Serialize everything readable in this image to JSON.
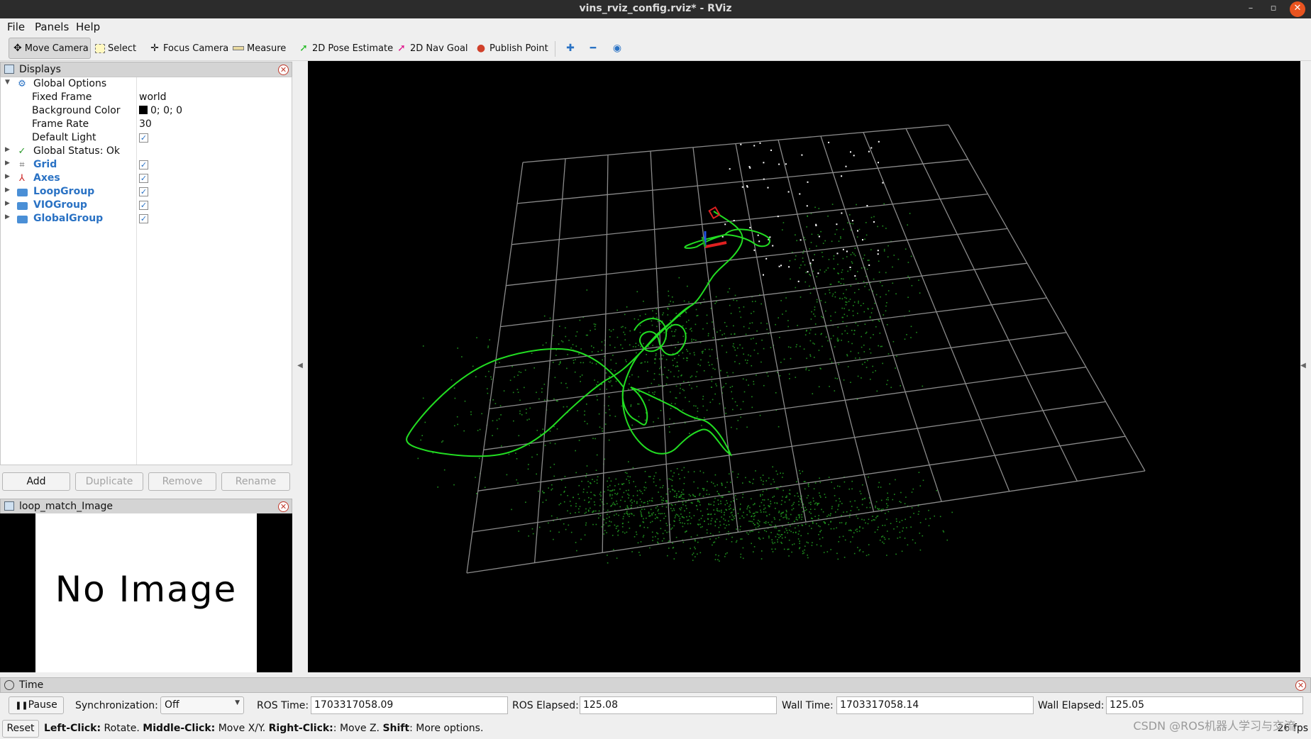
{
  "window": {
    "title": "vins_rviz_config.rviz* - RViz"
  },
  "menubar": {
    "file": "File",
    "panels": "Panels",
    "help": "Help"
  },
  "toolbar": {
    "move_camera": "Move Camera",
    "select": "Select",
    "focus_camera": "Focus Camera",
    "measure": "Measure",
    "pose_estimate": "2D Pose Estimate",
    "nav_goal": "2D Nav Goal",
    "publish_point": "Publish Point"
  },
  "displays": {
    "title": "Displays",
    "global_options": "Global Options",
    "fixed_frame_label": "Fixed Frame",
    "fixed_frame_value": "world",
    "background_color_label": "Background Color",
    "background_color_value": "0; 0; 0",
    "frame_rate_label": "Frame Rate",
    "frame_rate_value": "30",
    "default_light_label": "Default Light",
    "global_status": "Global Status: Ok",
    "items": [
      {
        "label": "Grid",
        "checked": true
      },
      {
        "label": "Axes",
        "checked": true
      },
      {
        "label": "LoopGroup",
        "checked": true
      },
      {
        "label": "VIOGroup",
        "checked": true
      },
      {
        "label": "GlobalGroup",
        "checked": true
      }
    ],
    "buttons": {
      "add": "Add",
      "duplicate": "Duplicate",
      "remove": "Remove",
      "rename": "Rename"
    }
  },
  "image_panel": {
    "title": "loop_match_Image",
    "placeholder": "No Image"
  },
  "time_panel": {
    "title": "Time",
    "pause": "Pause",
    "sync_label": "Synchronization:",
    "sync_value": "Off",
    "ros_time_label": "ROS Time:",
    "ros_time": "1703317058.09",
    "ros_elapsed_label": "ROS Elapsed:",
    "ros_elapsed": "125.08",
    "wall_time_label": "Wall Time:",
    "wall_time": "1703317058.14",
    "wall_elapsed_label": "Wall Elapsed:",
    "wall_elapsed": "125.05"
  },
  "statusbar": {
    "reset": "Reset",
    "k1": "Left-Click:",
    "v1": " Rotate. ",
    "k2": "Middle-Click:",
    "v2": " Move X/Y. ",
    "k3": "Right-Click:",
    "v3": ": Move Z. ",
    "k4": "Shift",
    "v4": ": More options.",
    "fps": "26 fps"
  },
  "watermark": "CSDN @ROS机器人学习与交流",
  "colors": {
    "trajectory": "#22dd22",
    "points": "#1f8f1f",
    "grid": "#8a8a8a",
    "background": "#000000",
    "link": "#2a72c4"
  }
}
